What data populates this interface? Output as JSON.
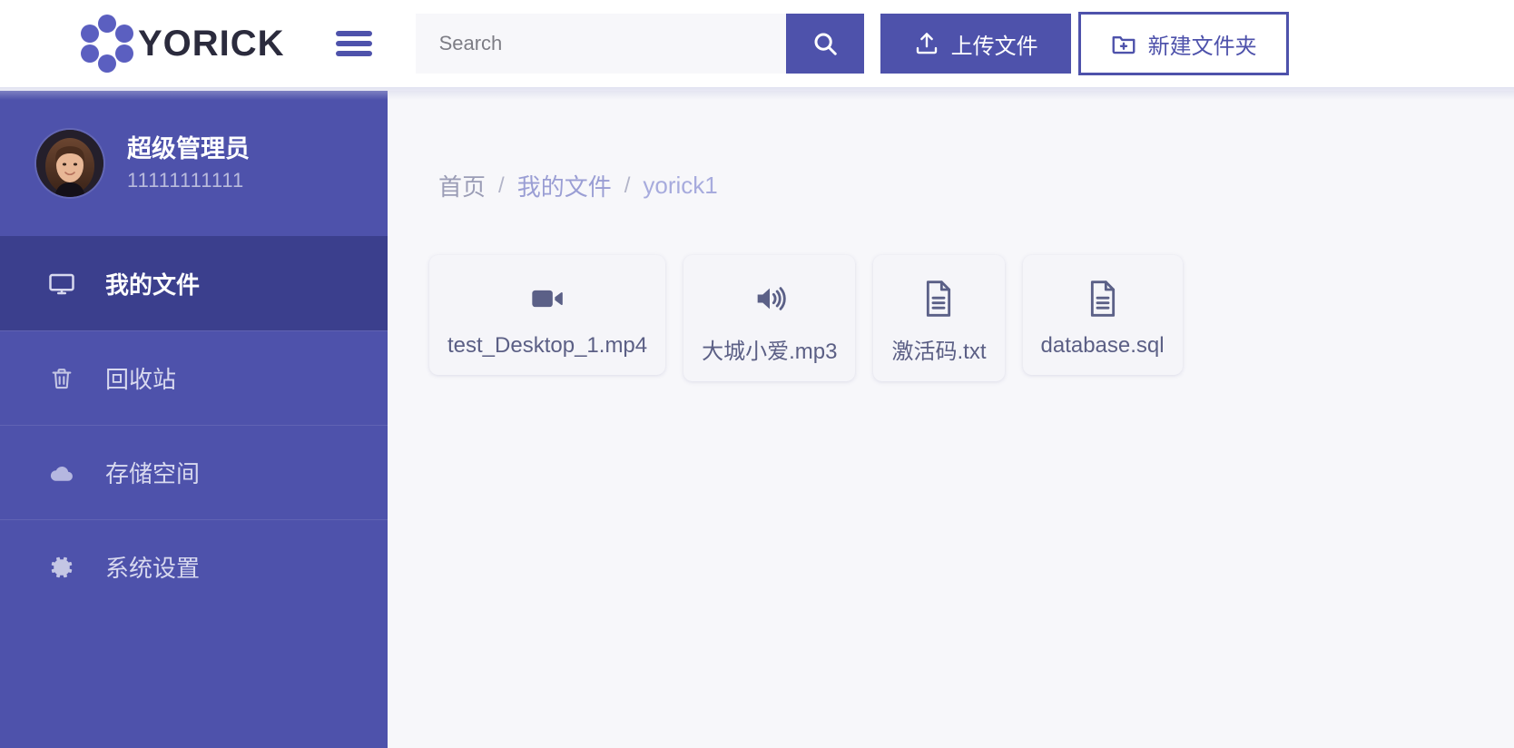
{
  "brand": {
    "name": "YORICK",
    "logo_icon": "hexagon-nodes-logo",
    "accent_color": "#4e52ab",
    "logo_text_color": "#2b2b3d"
  },
  "header": {
    "menu_icon": "hamburger-menu-icon",
    "search": {
      "placeholder": "Search",
      "value": "",
      "button_icon": "search-icon"
    },
    "upload_button": {
      "label": "上传文件",
      "icon": "upload-icon"
    },
    "new_folder_button": {
      "label": "新建文件夹",
      "icon": "folder-plus-icon"
    }
  },
  "sidebar": {
    "profile": {
      "avatar_icon": "user-avatar-photo",
      "name": "超级管理员",
      "phone": "11111111111"
    },
    "items": [
      {
        "label": "我的文件",
        "icon": "monitor-icon",
        "active": true
      },
      {
        "label": "回收站",
        "icon": "trash-icon",
        "active": false
      },
      {
        "label": "存储空间",
        "icon": "cloud-icon",
        "active": false
      },
      {
        "label": "系统设置",
        "icon": "gear-icon",
        "active": false
      }
    ]
  },
  "main": {
    "breadcrumb": [
      {
        "label": "首页",
        "type": "home"
      },
      {
        "label": "我的文件",
        "type": "link"
      },
      {
        "label": "yorick1",
        "type": "current"
      }
    ],
    "breadcrumb_separator": "/",
    "files": [
      {
        "name": "test_Desktop_1.mp4",
        "icon": "video-icon"
      },
      {
        "name": "大城小爱.mp3",
        "icon": "audio-speaker-icon"
      },
      {
        "name": "激活码.txt",
        "icon": "document-icon"
      },
      {
        "name": "database.sql",
        "icon": "document-icon"
      }
    ]
  }
}
